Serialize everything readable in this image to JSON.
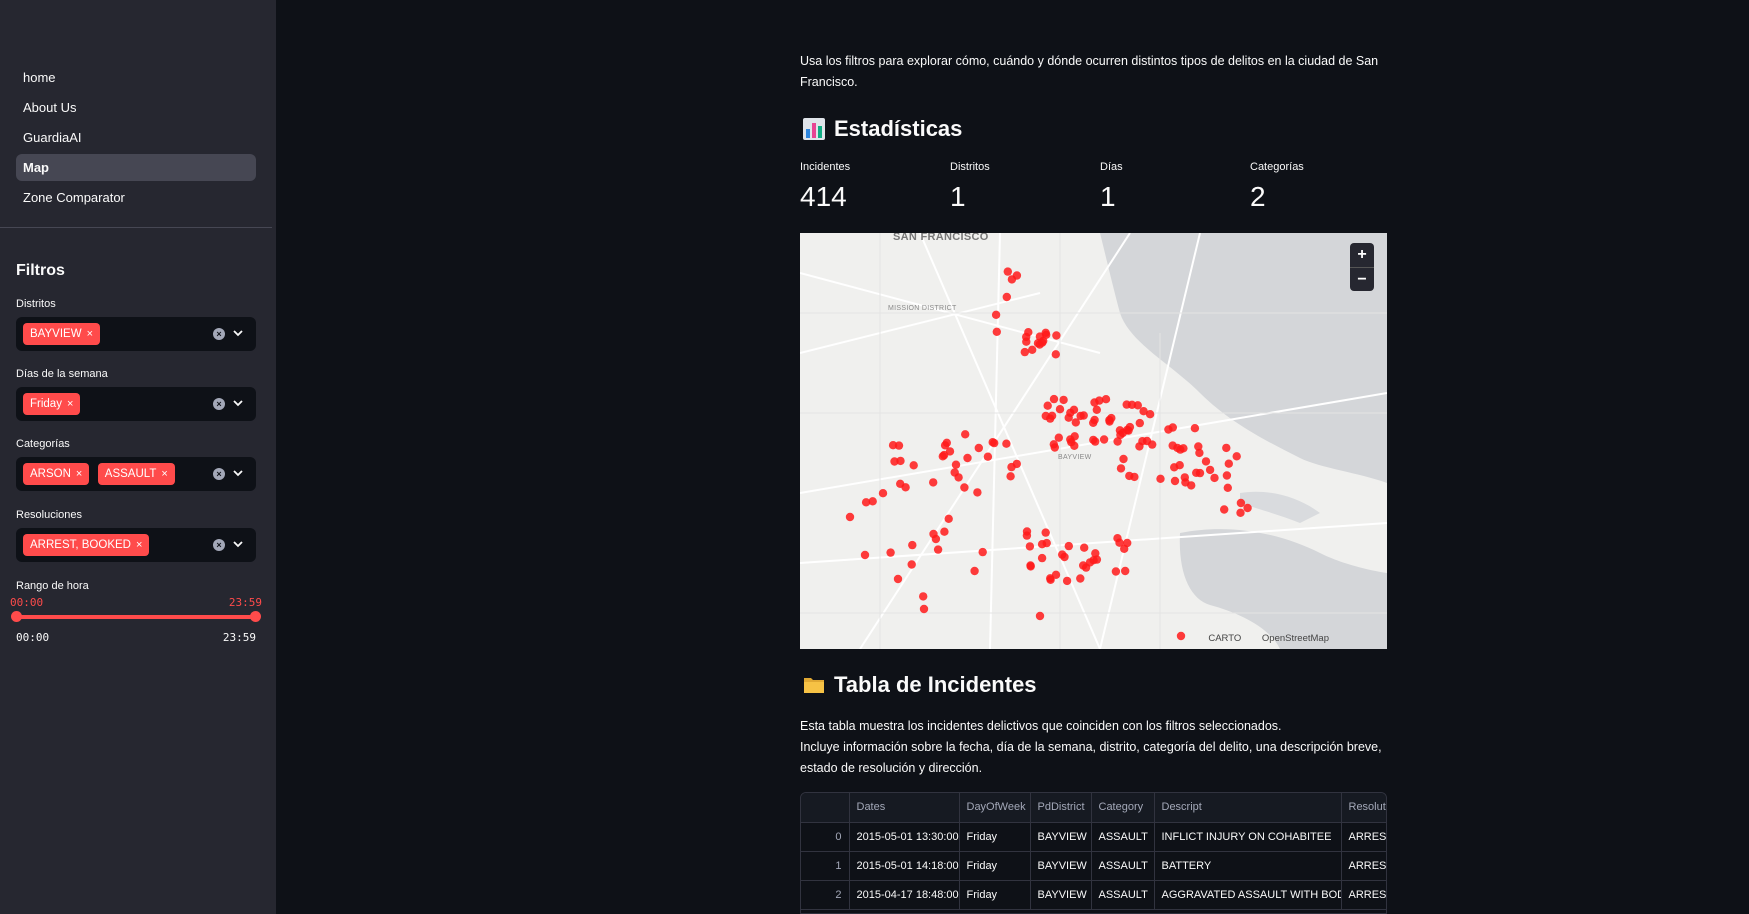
{
  "sidebar": {
    "nav": [
      "home",
      "About Us",
      "GuardiaAI",
      "Map",
      "Zone Comparator"
    ],
    "active_nav": "Map",
    "filters_title": "Filtros",
    "filters": [
      {
        "label": "Distritos",
        "tags": [
          "BAYVIEW"
        ]
      },
      {
        "label": "Días de la semana",
        "tags": [
          "Friday"
        ]
      },
      {
        "label": "Categorías",
        "tags": [
          "ARSON",
          "ASSAULT"
        ]
      },
      {
        "label": "Resoluciones",
        "tags": [
          "ARREST, BOOKED"
        ]
      }
    ],
    "hour_range": {
      "label": "Rango de hora",
      "min_label": "00:00",
      "max_label": "23:59",
      "start": "00:00",
      "end": "23:59",
      "start_fraction": 0.0,
      "end_fraction": 1.0
    }
  },
  "main": {
    "intro": "Usa los filtros para explorar cómo, cuándo y dónde ocurren distintos tipos de delitos en la ciudad de San Francisco.",
    "stats_heading": "Estadísticas",
    "stats_icon": "bar-chart-icon",
    "metrics": [
      {
        "label": "Incidentes",
        "value": "414"
      },
      {
        "label": "Distritos",
        "value": "1"
      },
      {
        "label": "Días",
        "value": "1"
      },
      {
        "label": "Categorías",
        "value": "2"
      }
    ],
    "map": {
      "place_labels": [
        "SAN FRANCISCO",
        "MISSION DISTRICT",
        "BAYVIEW"
      ],
      "attribution": [
        "CARTO",
        "OpenStreetMap"
      ],
      "zoom_in": "+",
      "zoom_out": "−",
      "point_color": "#ff1a1a"
    },
    "table_heading": "Tabla de Incidentes",
    "table_icon": "folder-icon",
    "table_desc_line1": "Esta tabla muestra los incidentes delictivos que coinciden con los filtros seleccionados.",
    "table_desc_line2": "Incluye información sobre la fecha, día de la semana, distrito, categoría del delito, una descripción breve, estado de resolución y dirección.",
    "table": {
      "columns": [
        "",
        "Dates",
        "DayOfWeek",
        "PdDistrict",
        "Category",
        "Descript",
        "Resolutio"
      ],
      "rows": [
        [
          "0",
          "2015-05-01 13:30:00",
          "Friday",
          "BAYVIEW",
          "ASSAULT",
          "INFLICT INJURY ON COHABITEE",
          "ARREST, B"
        ],
        [
          "1",
          "2015-05-01 14:18:00",
          "Friday",
          "BAYVIEW",
          "ASSAULT",
          "BATTERY",
          "ARREST, B"
        ],
        [
          "2",
          "2015-04-17 18:48:00",
          "Friday",
          "BAYVIEW",
          "ASSAULT",
          "AGGRAVATED ASSAULT WITH BODILY F",
          "ARREST, B"
        ]
      ]
    }
  },
  "colors": {
    "accent": "#ff4b4b",
    "background": "#0e1117",
    "sidebar": "#262730"
  }
}
